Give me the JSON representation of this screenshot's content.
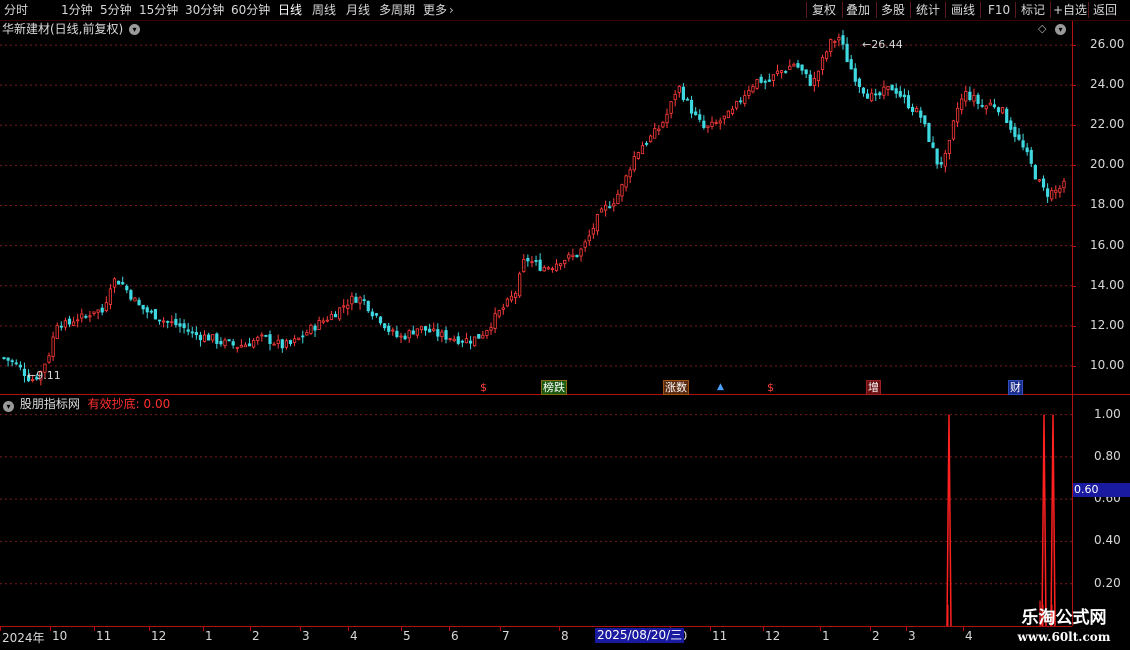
{
  "toolbar": {
    "periods": [
      "分时",
      "1分钟",
      "5分钟",
      "15分钟",
      "30分钟",
      "60分钟",
      "日线",
      "周线",
      "月线",
      "多周期",
      "更多"
    ],
    "active_period": "日线",
    "actions": [
      "复权",
      "叠加",
      "多股",
      "统计",
      "画线",
      "F10",
      "标记",
      "+自选",
      "返回"
    ]
  },
  "stock": {
    "title": "华新建材(日线,前复权)",
    "high_label": "26.44",
    "low_label": "9.11"
  },
  "main_axis": {
    "ticks": [
      "26.00",
      "24.00",
      "22.00",
      "20.00",
      "18.00",
      "16.00",
      "14.00",
      "12.00",
      "10.00"
    ]
  },
  "signals": [
    "$",
    "榜跌",
    "涨数",
    "▲",
    "$",
    "增",
    "财"
  ],
  "indicator": {
    "name": "股朋指标网",
    "line_label": "有效抄底: 0.00",
    "ticks": [
      "1.00",
      "0.80",
      "0.60",
      "0.40",
      "0.20"
    ],
    "cursor_value": "0.60"
  },
  "x_axis": {
    "labels": [
      "2024年",
      "10",
      "11",
      "12",
      "1",
      "2",
      "3",
      "4",
      "5",
      "6",
      "7",
      "8",
      "10",
      "11",
      "12",
      "1",
      "2",
      "3",
      "4"
    ],
    "cursor_date": "2025/08/20/三"
  },
  "watermark": {
    "title": "乐淘公式网",
    "url": "www.60lt.com"
  },
  "chart_data": [
    {
      "type": "candlestick",
      "title": "华新建材(日线,前复权)",
      "ylim": [
        8.6,
        27.2
      ],
      "yticks": [
        10,
        12,
        14,
        16,
        18,
        20,
        22,
        24,
        26
      ],
      "x": [
        "2024-09",
        "2024-10",
        "2024-11",
        "2024-12",
        "2025-01",
        "2025-02",
        "2025-03",
        "2025-04",
        "2025-05",
        "2025-06",
        "2025-07",
        "2025-08",
        "2025-10",
        "2025-11",
        "2025-12",
        "2026-01",
        "2026-02",
        "2026-03",
        "2026-04"
      ],
      "close_path": [
        10.4,
        10.2,
        9.8,
        9.3,
        9.6,
        10.6,
        12.3,
        12.0,
        12.4,
        12.4,
        12.8,
        12.7,
        14.3,
        14.2,
        13.6,
        13.0,
        12.7,
        12.5,
        12.2,
        12.1,
        11.9,
        11.6,
        11.5,
        11.4,
        11.2,
        11.1,
        11.0,
        11.1,
        11.3,
        11.4,
        11.2,
        11.0,
        11.1,
        11.4,
        11.8,
        12.1,
        12.4,
        12.7,
        13.1,
        13.4,
        13.3,
        12.7,
        12.3,
        11.7,
        11.4,
        11.6,
        11.9,
        11.8,
        11.6,
        11.5,
        11.4,
        11.3,
        11.3,
        11.5,
        12.0,
        12.6,
        13.1,
        13.7,
        15.4,
        15.1,
        14.9,
        15.0,
        15.3,
        15.4,
        15.6,
        16.3,
        17.3,
        17.9,
        18.3,
        19.1,
        20.3,
        21.0,
        21.4,
        21.9,
        22.7,
        24.0,
        23.2,
        22.4,
        21.8,
        22.0,
        22.3,
        22.6,
        23.3,
        23.9,
        24.3,
        24.1,
        24.6,
        24.8,
        25.1,
        24.6,
        24.0,
        25.1,
        26.1,
        26.4,
        25.1,
        24.2,
        23.6,
        23.3,
        23.7,
        23.9,
        23.4,
        22.9,
        22.5,
        21.3,
        20.0,
        20.5,
        22.7,
        23.6,
        23.3,
        22.9,
        23.1,
        22.8,
        22.0,
        21.2,
        20.4,
        19.3,
        18.6,
        18.7,
        19.0
      ],
      "high": 26.44,
      "low": 9.11
    },
    {
      "type": "line",
      "series": [
        {
          "name": "有效抄底",
          "values": [
            0,
            0,
            0,
            0,
            0,
            0,
            0,
            0,
            0,
            0,
            0,
            0,
            0,
            0,
            0,
            0,
            0,
            0,
            1.0,
            0,
            0,
            0,
            0,
            0,
            0,
            0,
            0,
            0,
            0,
            1.0,
            0,
            1.0,
            0
          ]
        }
      ],
      "ylim": [
        0,
        1.05
      ],
      "yticks": [
        0.2,
        0.4,
        0.6,
        0.8,
        1.0
      ]
    }
  ]
}
